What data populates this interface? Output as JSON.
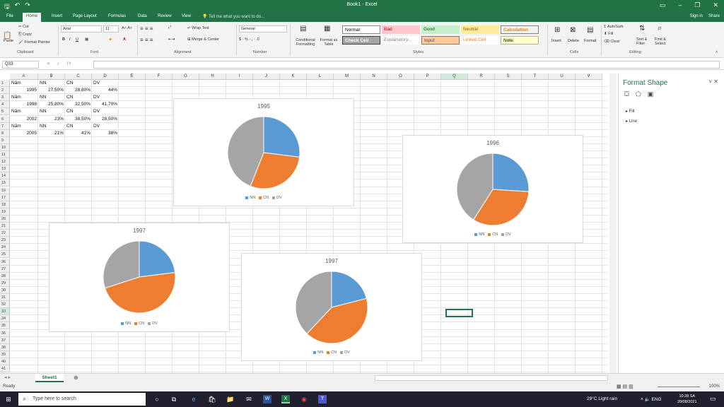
{
  "window": {
    "title": "Book1 - Excel"
  },
  "tabs": [
    "File",
    "Home",
    "Insert",
    "Page Layout",
    "Formulas",
    "Data",
    "Review",
    "View"
  ],
  "tell_me": "Tell me what you want to do...",
  "account": {
    "signin": "Sign in",
    "share": "Share"
  },
  "ribbon": {
    "clipboard": {
      "cut": "Cut",
      "copy": "Copy",
      "format_painter": "Format Painter",
      "paste": "Paste",
      "label": "Clipboard"
    },
    "font": {
      "family": "Arial",
      "size": "11",
      "label": "Font"
    },
    "alignment": {
      "wrap": "Wrap Text",
      "merge": "Merge & Center",
      "label": "Alignment"
    },
    "number": {
      "format": "General",
      "label": "Number"
    },
    "styles": {
      "conditional": "Conditional Formatting",
      "format_as_table": "Format as Table",
      "cells": [
        {
          "name": "Normal",
          "bg": "#ffffff",
          "fg": "#000000"
        },
        {
          "name": "Bad",
          "bg": "#ffc7ce",
          "fg": "#9c0006"
        },
        {
          "name": "Good",
          "bg": "#c6efce",
          "fg": "#006100"
        },
        {
          "name": "Neutral",
          "bg": "#ffeb9c",
          "fg": "#9c5700"
        },
        {
          "name": "Calculation",
          "bg": "#f2f2f2",
          "fg": "#fa7d00"
        },
        {
          "name": "Check Cell",
          "bg": "#a5a5a5",
          "fg": "#ffffff"
        },
        {
          "name": "Explanatory...",
          "bg": "#ffffff",
          "fg": "#7f7f7f"
        },
        {
          "name": "Input",
          "bg": "#ffcc99",
          "fg": "#3f3f76"
        },
        {
          "name": "Linked Cell",
          "bg": "#ffffff",
          "fg": "#fa7d00"
        },
        {
          "name": "Note",
          "bg": "#ffffcc",
          "fg": "#000000"
        }
      ],
      "label": "Styles"
    },
    "cells": {
      "insert": "Insert",
      "delete": "Delete",
      "format": "Format",
      "label": "Cells"
    },
    "editing": {
      "autosum": "AutoSum",
      "fill": "Fill",
      "clear": "Clear",
      "sort": "Sort & Filter",
      "find": "Find & Select",
      "label": "Editing"
    }
  },
  "formula_bar": {
    "name_box": "Q33",
    "content": ""
  },
  "columns": [
    "A",
    "B",
    "C",
    "D",
    "E",
    "F",
    "G",
    "H",
    "I",
    "J",
    "K",
    "L",
    "M",
    "N",
    "O",
    "P",
    "Q",
    "R",
    "S",
    "T",
    "U",
    "V"
  ],
  "rows": [
    "1",
    "2",
    "3",
    "4",
    "5",
    "6",
    "7",
    "8",
    "9",
    "10",
    "11",
    "12",
    "13",
    "14",
    "15",
    "16",
    "17",
    "18",
    "19",
    "20",
    "21",
    "22",
    "23",
    "24",
    "25",
    "26",
    "27",
    "28",
    "29",
    "30",
    "31",
    "32",
    "33",
    "34",
    "35",
    "36",
    "37",
    "38",
    "39",
    "40",
    "41"
  ],
  "cells": {
    "A1": "Năm",
    "B1": "NN",
    "C1": "CN",
    "D1": "DV",
    "A2": "1995",
    "B2": "27,50%",
    "C2": "28,80%",
    "D2": "44%",
    "A3": "Năm",
    "B3": "NN",
    "C3": "CN",
    "D3": "DV",
    "A4": "1998",
    "B4": "25,80%",
    "C4": "32,50%",
    "D4": "41,70%",
    "A5": "Năm",
    "B5": "NN",
    "C5": "CN",
    "D5": "DV",
    "A6": "2002",
    "B6": "23%",
    "C6": "38,50%",
    "D6": "28,50%",
    "A7": "Năm",
    "B7": "NN",
    "C7": "CN",
    "D7": "DV",
    "A8": "2005",
    "B8": "21%",
    "C8": "41%",
    "D8": "38%"
  },
  "chart_data": [
    {
      "type": "pie",
      "title": "1995",
      "categories": [
        "NN",
        "CN",
        "DV"
      ],
      "values": [
        27,
        29,
        44
      ],
      "colors": [
        "#5b9bd5",
        "#ed7d31",
        "#a5a5a5"
      ]
    },
    {
      "type": "pie",
      "title": "1996",
      "categories": [
        "NN",
        "CN",
        "DV"
      ],
      "values": [
        26,
        33,
        41
      ],
      "colors": [
        "#5b9bd5",
        "#ed7d31",
        "#a5a5a5"
      ]
    },
    {
      "type": "pie",
      "title": "1997",
      "categories": [
        "NN",
        "CN",
        "DV"
      ],
      "values": [
        23,
        47,
        30
      ],
      "colors": [
        "#5b9bd5",
        "#ed7d31",
        "#a5a5a5"
      ]
    },
    {
      "type": "pie",
      "title": "1997",
      "categories": [
        "NN",
        "CN",
        "DV"
      ],
      "values": [
        21,
        41,
        38
      ],
      "colors": [
        "#5b9bd5",
        "#ed7d31",
        "#a5a5a5"
      ]
    }
  ],
  "format_pane": {
    "title": "Format Shape",
    "sections": [
      "Fill",
      "Line"
    ]
  },
  "sheet_tabs": [
    "Sheet1"
  ],
  "status": {
    "ready": "Ready",
    "zoom": "100%"
  },
  "taskbar": {
    "search": "Type here to search",
    "weather": "29°C Light rain",
    "lang": "ENG",
    "time": "10:28 SA",
    "date": "20/08/2021"
  }
}
